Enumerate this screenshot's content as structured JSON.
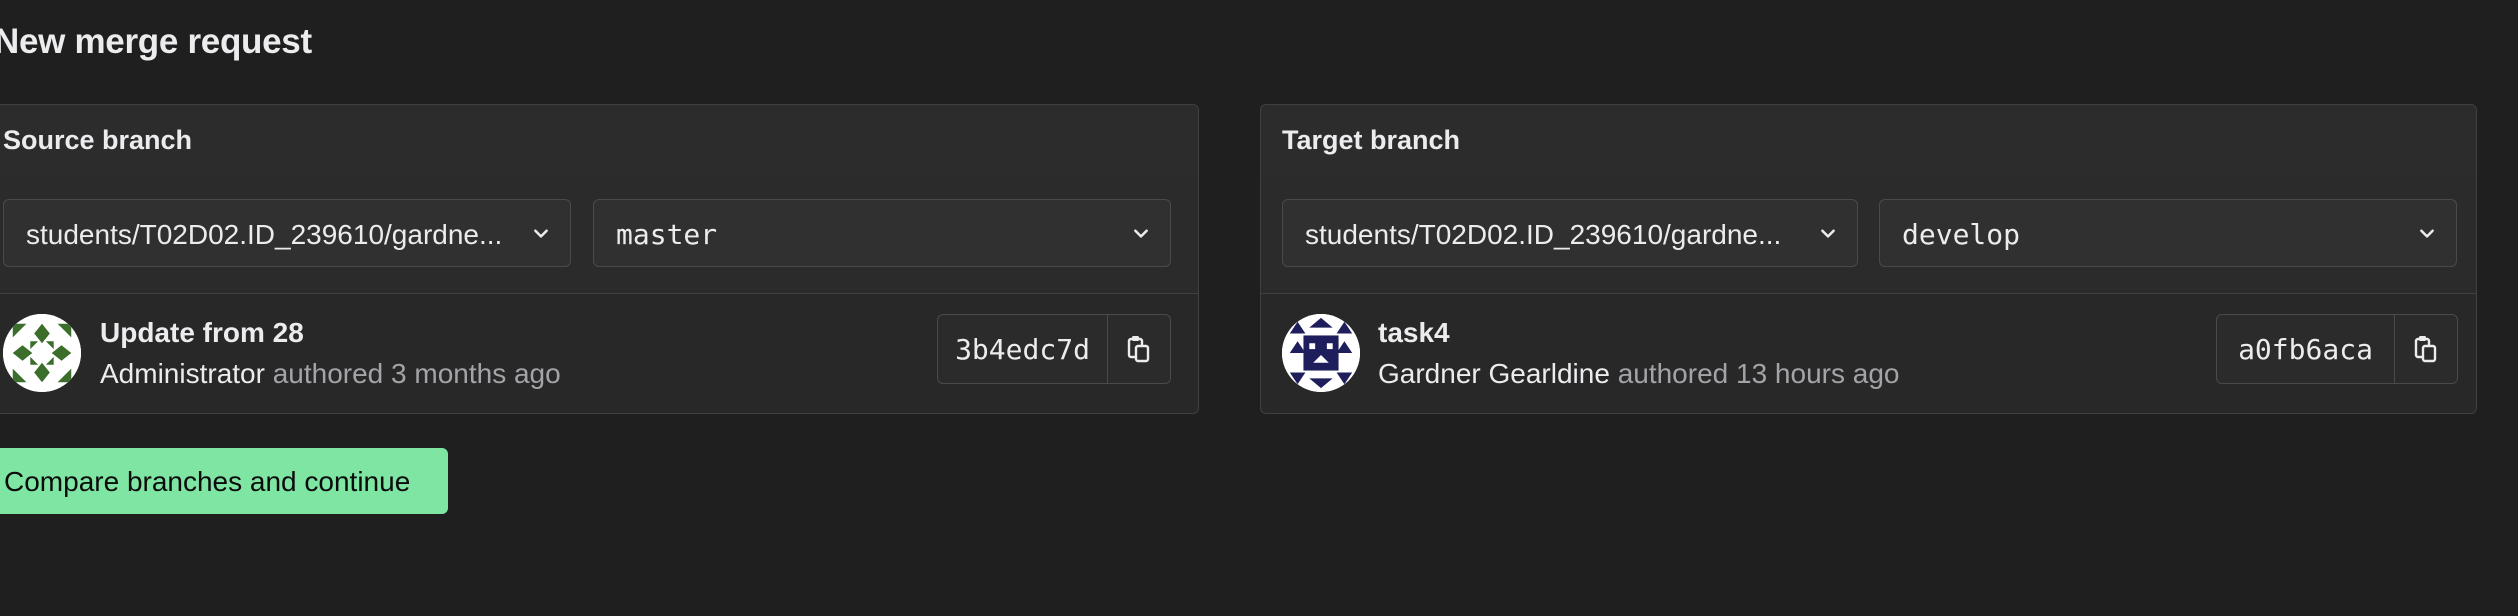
{
  "page": {
    "title": "New merge request"
  },
  "source": {
    "header": "Source branch",
    "project": "students/T02D02.ID_239610/gardne...",
    "branch": "master",
    "commit": {
      "title": "Update from 28",
      "author": "Administrator",
      "authored": "authored 3 months ago",
      "sha": "3b4edc7d"
    }
  },
  "target": {
    "header": "Target branch",
    "project": "students/T02D02.ID_239610/gardne...",
    "branch": "develop",
    "commit": {
      "title": "task4",
      "author": "Gardner Gearldine",
      "authored": "authored 13 hours ago",
      "sha": "a0fb6aca"
    }
  },
  "actions": {
    "compare_label": "Compare branches and continue"
  },
  "icons": {
    "dropdown": "chevron-down-icon",
    "copy": "copy-to-clipboard-icon"
  },
  "colors": {
    "background": "#1f1f1f",
    "panel": "#282828",
    "border": "#404040",
    "primary_button": "#7ee5a3",
    "muted_text": "#a4a3a8"
  }
}
